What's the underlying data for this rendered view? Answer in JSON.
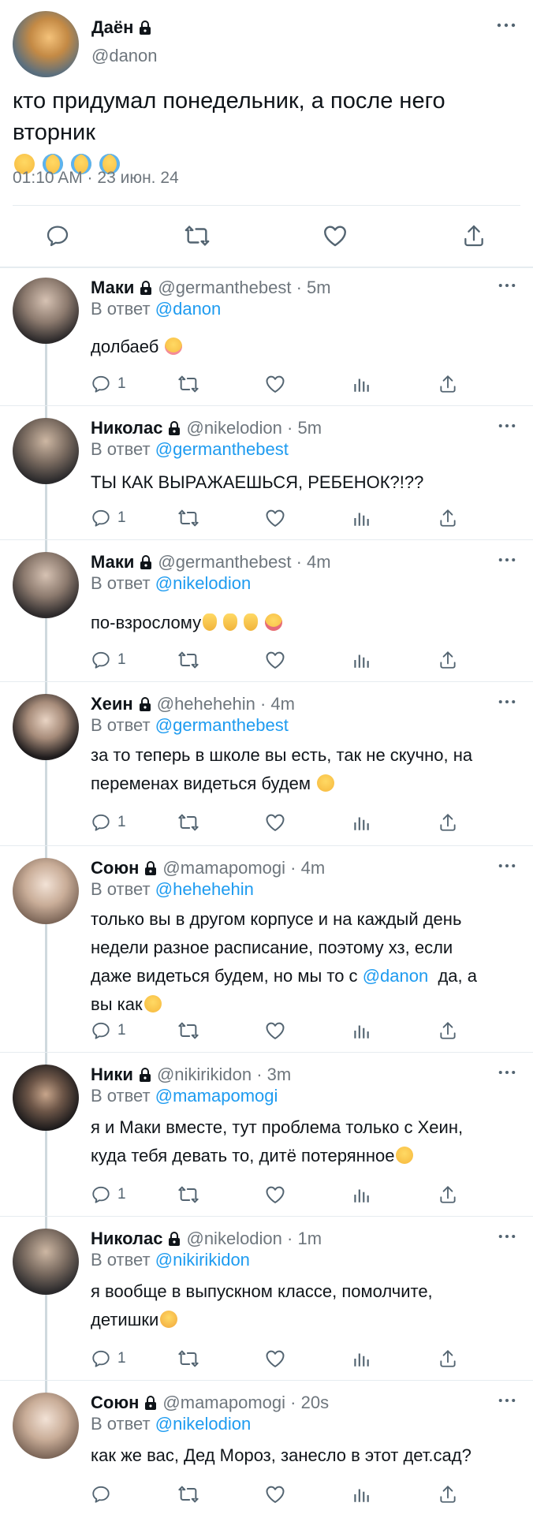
{
  "main": {
    "name": "Даён",
    "handle": "@danon",
    "text": "кто придумал понедельник, а после него вторник",
    "emojis": [
      "pleading-face",
      "loudly-crying-face",
      "loudly-crying-face",
      "loudly-crying-face"
    ],
    "timestamp": "01:10 AM · 23 июн. 24",
    "actions": [
      "reply-icon",
      "retweet-icon",
      "like-icon",
      "share-icon"
    ]
  },
  "replying_prefix": "В ответ",
  "replies": [
    {
      "name": "Маки",
      "handle": "@germanthebest",
      "time": "5m",
      "reply_to": "@danon",
      "text": "долбаеб",
      "emoji": "smiling-face-with-hearts",
      "replies_count": "1"
    },
    {
      "name": "Николас",
      "handle": "@nikelodion",
      "time": "5m",
      "reply_to": "@germanthebest",
      "text": "ТЫ КАК ВЫРАЖАЕШЬСЯ, РЕБЕНОК?!??",
      "replies_count": "1"
    },
    {
      "name": "Маки",
      "handle": "@germanthebest",
      "time": "4m",
      "reply_to": "@nikelodion",
      "text": "по-взрослому",
      "emoji": "sign-of-the-horns x3, zany-face",
      "replies_count": "1"
    },
    {
      "name": "Хеин",
      "handle": "@hehehehin",
      "time": "4m",
      "reply_to": "@germanthebest",
      "text_line1": "за то теперь в школе вы есть, так не скучно, на",
      "text_line2": "переменах видеться будем",
      "emoji": "pleading-face",
      "replies_count": "1"
    },
    {
      "name": "Союн",
      "handle": "@mamapomogi",
      "time": "4m",
      "reply_to": "@hehehehin",
      "text_line1": "только вы в другом корпусе и на каждый день",
      "text_line2": "недели разное расписание, поэтому хз, если",
      "text_line3a": "даже видеться будем, но мы то с",
      "mention": "@danon",
      "text_line3b": "да, а",
      "text_line4": "вы как",
      "emoji": "pensive-face",
      "replies_count": "1"
    },
    {
      "name": "Ники",
      "handle": "@nikirikidon",
      "time": "3m",
      "reply_to": "@mamapomogi",
      "text_line1": "я и Маки вместе, тут проблема только с Хеин,",
      "text_line2": "куда тебя девать то, дитё потерянное",
      "emoji": "pleading-face",
      "replies_count": "1"
    },
    {
      "name": "Николас",
      "handle": "@nikelodion",
      "time": "1m",
      "reply_to": "@nikirikidon",
      "text_line1": "я вообще в выпускном классе, помолчите,",
      "text_line2": "детишки",
      "emoji": "tired-face",
      "replies_count": "1"
    },
    {
      "name": "Союн",
      "handle": "@mamapomogi",
      "time": "20s",
      "reply_to": "@nikelodion",
      "text": "как же вас, Дед Мороз, занесло в этот дет.сад?",
      "replies_count": ""
    }
  ],
  "colors": {
    "link": "#1d9bf0",
    "muted": "#6e767d",
    "divider": "#e6ecf0"
  }
}
